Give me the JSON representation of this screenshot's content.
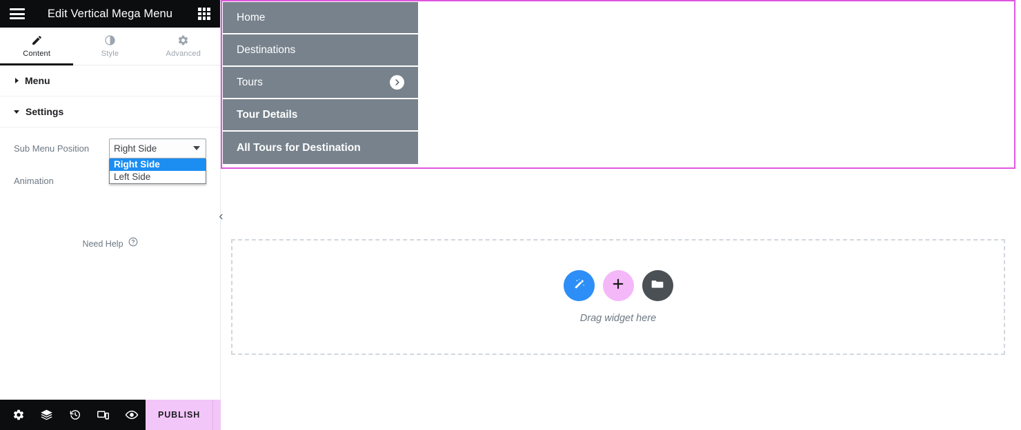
{
  "panel": {
    "header": {
      "title": "Edit Vertical Mega Menu",
      "menu_icon": "hamburger-icon",
      "apps_icon": "grid-apps-icon"
    },
    "tabs": [
      {
        "label": "Content",
        "icon": "pencil-icon",
        "active": true
      },
      {
        "label": "Style",
        "icon": "contrast-circle-icon",
        "active": false
      },
      {
        "label": "Advanced",
        "icon": "gear-icon",
        "active": false
      }
    ],
    "sections": [
      {
        "title": "Menu",
        "expanded": false,
        "caret": "caret-right-icon"
      },
      {
        "title": "Settings",
        "expanded": true,
        "caret": "caret-down-icon"
      }
    ],
    "controls": {
      "sub_menu_position": {
        "label": "Sub Menu Position",
        "value": "Right Side",
        "options": [
          "Right Side",
          "Left Side"
        ],
        "open": true
      },
      "animation": {
        "label": "Animation"
      }
    },
    "need_help": {
      "label": "Need Help",
      "icon": "question-circle-icon"
    },
    "footer": {
      "tools": [
        {
          "name": "settings-gear-icon",
          "title": "Settings"
        },
        {
          "name": "layers-navigator-icon",
          "title": "Navigator"
        },
        {
          "name": "history-clock-icon",
          "title": "History"
        },
        {
          "name": "responsive-device-icon",
          "title": "Responsive Mode"
        },
        {
          "name": "preview-eye-icon",
          "title": "Preview Changes"
        }
      ],
      "publish_label": "PUBLISH",
      "publish_caret_icon": "chevron-up-icon"
    }
  },
  "canvas": {
    "collapse_handle_icon": "chevron-left-icon",
    "section_border_color": "#e055e0",
    "vertical_menu": {
      "background_color": "#77828c",
      "items": [
        {
          "label": "Home",
          "has_submenu": false,
          "bold": false
        },
        {
          "label": "Destinations",
          "has_submenu": false,
          "bold": false
        },
        {
          "label": "Tours",
          "has_submenu": true,
          "bold": false,
          "submenu_icon": "chevron-right-circle-icon"
        },
        {
          "label": "Tour Details",
          "has_submenu": false,
          "bold": true
        },
        {
          "label": "All Tours for Destination",
          "has_submenu": false,
          "bold": true
        }
      ]
    },
    "drop_zone": {
      "hint": "Drag widget here",
      "buttons": [
        {
          "name": "ai-magic-wand-button",
          "icon": "magic-wand-icon",
          "color": "#2e8ef7"
        },
        {
          "name": "add-widget-button",
          "icon": "plus-icon",
          "color": "#f4b8f9"
        },
        {
          "name": "template-folder-button",
          "icon": "folder-icon",
          "color": "#4b5055"
        }
      ]
    }
  }
}
